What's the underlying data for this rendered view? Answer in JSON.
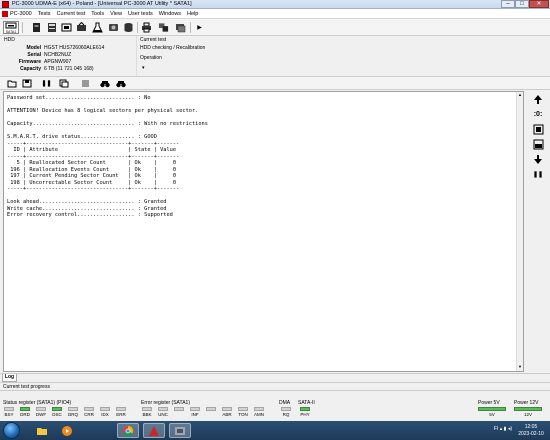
{
  "window": {
    "title": "PC-3000 UDMA-E (x64) - Poland - [Universal PC-3000 AT Utility * SATA1]",
    "minimize": "–",
    "maximize": "□",
    "close": "✕"
  },
  "menu": {
    "items": [
      "PC-3000",
      "Tests",
      "Current test",
      "Tools",
      "View",
      "User tests",
      "Windows",
      "Help"
    ]
  },
  "toolbar": {
    "buttons": [
      {
        "icon": "sata-port-icon",
        "label": "SATA1",
        "selected": true
      },
      {
        "icon": "drive-chip-icon"
      },
      {
        "icon": "drive-info-icon"
      },
      {
        "icon": "media-icon"
      },
      {
        "icon": "reset-icon"
      },
      {
        "icon": "flask-icon"
      },
      {
        "icon": "hdd-icon"
      },
      {
        "icon": "database-icon"
      },
      {
        "icon": "printer-icon"
      },
      {
        "icon": "tools-icon"
      },
      {
        "icon": "more-arrow-icon"
      }
    ]
  },
  "hdd": {
    "header": "HDD",
    "model_label": "Model",
    "model": "HGST HUS726060ALE614",
    "serial_label": "Serial",
    "serial": "NCHB2NUZ",
    "firmware_label": "Firmware",
    "firmware": "APGNW907",
    "capacity_label": "Capacity",
    "capacity": "6 TB (11 721 045 168)"
  },
  "current_test": {
    "header": "Current test",
    "name": "HDD checking / Recalibration",
    "operation_label": "Operation"
  },
  "toolbar2": {
    "buttons": [
      "open-folder-icon",
      "save-icon",
      "pause-icon",
      "copy-icon",
      "clear-icon",
      "binoculars-icon",
      "binoculars-next-icon"
    ]
  },
  "log_text": [
    "Password set............................ : No",
    "",
    "ATTENTION! Device has 8 logical sectors per physical sector.",
    "",
    "Capacity................................ : With no restrictions",
    "",
    "S.M.A.R.T. drive status................. : GOOD",
    "-----+--------------------------------+-------+-------",
    "  ID | Attribute                      | State | Value",
    "-----+--------------------------------+-------+-------",
    "   5 | Reallocated Sector Count       | Ok    |     0",
    " 196 | Reallocation Events Count      | Ok    |     0",
    " 197 | Current Pending Sector Count   | Ok    |     0",
    " 198 | Uncorrectable Sector Count     | Ok    |     0",
    "-----+--------------------------------+-------+-------",
    "",
    "Look ahead.............................. : Granted",
    "Write cache............................. : Granted",
    "Error recovery control.................. : Supported"
  ],
  "log_tab": "Log",
  "progress_label": "Current test progress",
  "status_register": {
    "label": "Status register (SATA1) (PIO4)",
    "leds": [
      {
        "name": "BSY",
        "on": false
      },
      {
        "name": "DRD",
        "on": true
      },
      {
        "name": "DWF",
        "on": false
      },
      {
        "name": "DSC",
        "on": true
      },
      {
        "name": "DRQ",
        "on": false
      },
      {
        "name": "CRR",
        "on": false
      },
      {
        "name": "IDX",
        "on": false
      },
      {
        "name": "ERR",
        "on": false
      }
    ]
  },
  "error_register": {
    "label": "Error register (SATA1)",
    "leds": [
      {
        "name": "BBK",
        "on": false
      },
      {
        "name": "UNC",
        "on": false
      },
      {
        "name": "",
        "on": false
      },
      {
        "name": "INF",
        "on": false
      },
      {
        "name": "",
        "on": false
      },
      {
        "name": "ABR",
        "on": false
      },
      {
        "name": "TON",
        "on": false
      },
      {
        "name": "AMN",
        "on": false
      }
    ]
  },
  "dma": {
    "label": "DMA",
    "led": "RQ",
    "on": false
  },
  "sata": {
    "label": "SATA-II",
    "led": "PHY",
    "on": true
  },
  "power5": {
    "label": "Power 5V",
    "value": "5V",
    "on": true
  },
  "power12": {
    "label": "Power 12V",
    "value": "12V",
    "on": true
  },
  "taskbar": {
    "apps": [
      "explorer-icon",
      "media-player-icon",
      "chrome-icon",
      "pc3000-icon",
      "tool-icon"
    ],
    "lang": "FI",
    "time": "12:05",
    "date": "2023-02-10"
  },
  "colors": {
    "led_on": "#5fb85f",
    "led_off": "#d2d2d2",
    "taskbar": "#1d3a58"
  }
}
